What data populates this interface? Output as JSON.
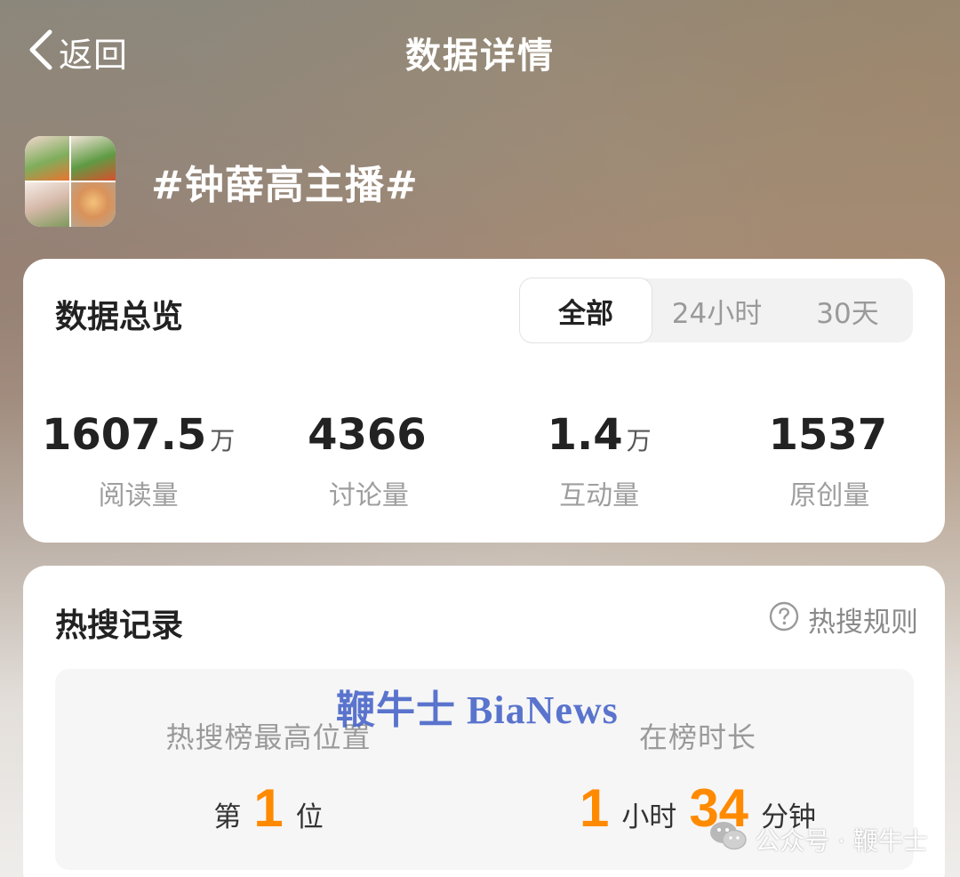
{
  "nav": {
    "back_label": "返回",
    "title": "数据详情"
  },
  "topic": {
    "title": "#钟薛高主播#"
  },
  "overview": {
    "title": "数据总览",
    "tabs": [
      "全部",
      "24小时",
      "30天"
    ],
    "active_tab": "全部",
    "stats": [
      {
        "value": "1607.5",
        "unit": "万",
        "label": "阅读量"
      },
      {
        "value": "4366",
        "unit": "",
        "label": "讨论量"
      },
      {
        "value": "1.4",
        "unit": "万",
        "label": "互动量"
      },
      {
        "value": "1537",
        "unit": "",
        "label": "原创量"
      }
    ]
  },
  "hot": {
    "title": "热搜记录",
    "rules_label": "热搜规则",
    "best_position": {
      "label": "热搜榜最高位置",
      "prefix": "第",
      "number": "1",
      "suffix": "位"
    },
    "duration": {
      "label": "在榜时长",
      "hours": "1",
      "hours_unit": "小时",
      "minutes": "34",
      "minutes_unit": "分钟"
    }
  },
  "watermark": {
    "text": "鞭牛士 BiaNews"
  },
  "footer": {
    "brand": "公众号 · 鞭牛士"
  },
  "colors": {
    "accent": "#ff8a00",
    "watermark": "#4a67c9"
  }
}
